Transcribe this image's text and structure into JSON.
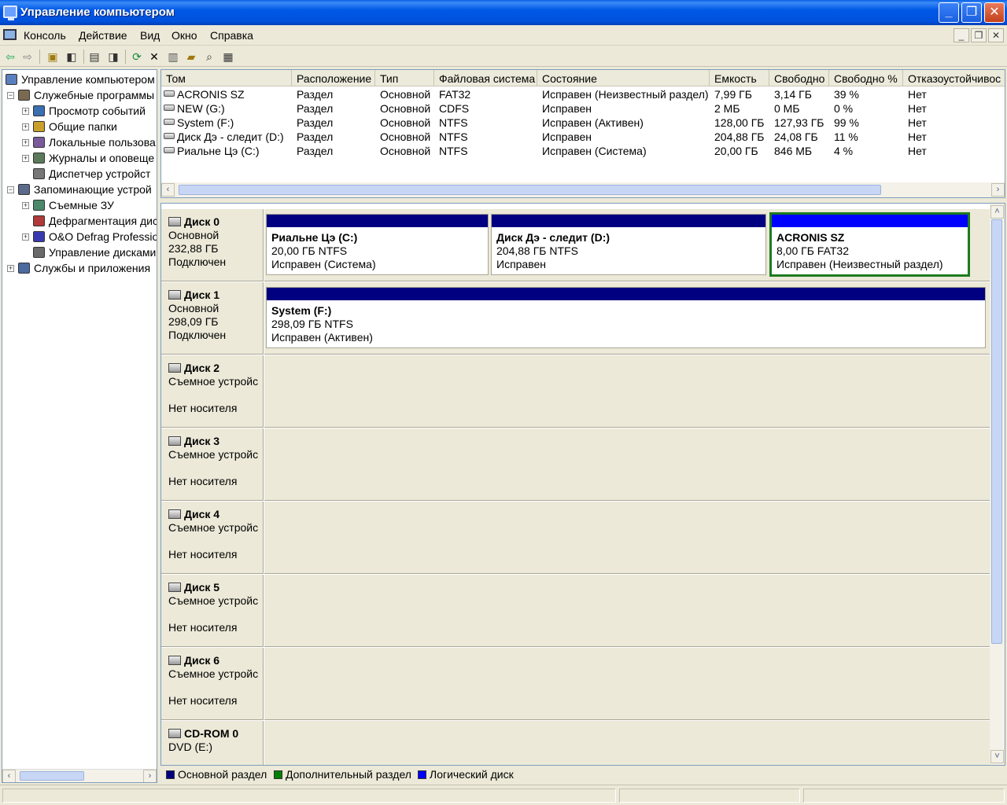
{
  "window": {
    "title": "Управление компьютером"
  },
  "menu": [
    "Консоль",
    "Действие",
    "Вид",
    "Окно",
    "Справка"
  ],
  "tree": [
    {
      "label": "Управление компьютером",
      "indent": 0,
      "exp": "",
      "icon": "computer-icon"
    },
    {
      "label": "Служебные программы",
      "indent": 1,
      "exp": "−",
      "icon": "tools-icon"
    },
    {
      "label": "Просмотр событий",
      "indent": 2,
      "exp": "+",
      "icon": "event-viewer-icon"
    },
    {
      "label": "Общие папки",
      "indent": 2,
      "exp": "+",
      "icon": "shared-folder-icon"
    },
    {
      "label": "Локальные пользова",
      "indent": 2,
      "exp": "+",
      "icon": "users-icon"
    },
    {
      "label": "Журналы и оповеще",
      "indent": 2,
      "exp": "+",
      "icon": "logs-icon"
    },
    {
      "label": "Диспетчер устройст",
      "indent": 2,
      "exp": "",
      "icon": "device-manager-icon"
    },
    {
      "label": "Запоминающие устрой",
      "indent": 1,
      "exp": "−",
      "icon": "storage-icon"
    },
    {
      "label": "Съемные ЗУ",
      "indent": 2,
      "exp": "+",
      "icon": "removable-storage-icon"
    },
    {
      "label": "Дефрагментация дис",
      "indent": 2,
      "exp": "",
      "icon": "defrag-icon"
    },
    {
      "label": "O&O Defrag Professio",
      "indent": 2,
      "exp": "+",
      "icon": "oo-defrag-icon"
    },
    {
      "label": "Управление дисками",
      "indent": 2,
      "exp": "",
      "icon": "disk-management-icon"
    },
    {
      "label": "Службы и приложения",
      "indent": 1,
      "exp": "+",
      "icon": "services-icon"
    }
  ],
  "columns": [
    "Том",
    "Расположение",
    "Тип",
    "Файловая система",
    "Состояние",
    "Емкость",
    "Свободно",
    "Свободно %",
    "Отказоустойчивос"
  ],
  "volumes": [
    [
      "ACRONIS SZ",
      "Раздел",
      "Основной",
      "FAT32",
      "Исправен (Неизвестный раздел)",
      "7,99 ГБ",
      "3,14 ГБ",
      "39 %",
      "Нет"
    ],
    [
      "NEW (G:)",
      "Раздел",
      "Основной",
      "CDFS",
      "Исправен",
      "2 МБ",
      "0 МБ",
      "0 %",
      "Нет"
    ],
    [
      "System (F:)",
      "Раздел",
      "Основной",
      "NTFS",
      "Исправен (Активен)",
      "128,00 ГБ",
      "127,93 ГБ",
      "99 %",
      "Нет"
    ],
    [
      "Диск Дэ - следит (D:)",
      "Раздел",
      "Основной",
      "NTFS",
      "Исправен",
      "204,88 ГБ",
      "24,08 ГБ",
      "11 %",
      "Нет"
    ],
    [
      "Риальне Цэ (C:)",
      "Раздел",
      "Основной",
      "NTFS",
      "Исправен (Система)",
      "20,00 ГБ",
      "846 МБ",
      "4 %",
      "Нет"
    ]
  ],
  "disks": [
    {
      "name": "Диск 0",
      "line2": "Основной",
      "line3": "232,88 ГБ",
      "line4": "Подключен",
      "partitions": [
        {
          "name": "Риальне Цэ  (C:)",
          "size": "20,00 ГБ NTFS",
          "status": "Исправен (Система)"
        },
        {
          "name": "Диск Дэ - следит  (D:)",
          "size": "204,88 ГБ NTFS",
          "status": "Исправен"
        },
        {
          "name": "ACRONIS SZ",
          "size": "8,00 ГБ FAT32",
          "status": "Исправен (Неизвестный раздел)"
        }
      ]
    },
    {
      "name": "Диск 1",
      "line2": "Основной",
      "line3": "298,09 ГБ",
      "line4": "Подключен",
      "partitions": [
        {
          "name": "System  (F:)",
          "size": "298,09 ГБ NTFS",
          "status": "Исправен (Активен)"
        }
      ]
    },
    {
      "name": "Диск 2",
      "line2": "Съемное устройс",
      "line3": "",
      "line4": "Нет носителя",
      "partitions": []
    },
    {
      "name": "Диск 3",
      "line2": "Съемное устройс",
      "line3": "",
      "line4": "Нет носителя",
      "partitions": []
    },
    {
      "name": "Диск 4",
      "line2": "Съемное устройс",
      "line3": "",
      "line4": "Нет носителя",
      "partitions": []
    },
    {
      "name": "Диск 5",
      "line2": "Съемное устройс",
      "line3": "",
      "line4": "Нет носителя",
      "partitions": []
    },
    {
      "name": "Диск 6",
      "line2": "Съемное устройс",
      "line3": "",
      "line4": "Нет носителя",
      "partitions": []
    },
    {
      "name": "CD-ROM 0",
      "line2": "DVD (E:)",
      "line3": "",
      "line4": "",
      "partitions": []
    }
  ],
  "legend": [
    {
      "label": "Основной раздел",
      "color": "#000080"
    },
    {
      "label": "Дополнительный раздел",
      "color": "#008000"
    },
    {
      "label": "Логический диск",
      "color": "#0000ff"
    }
  ],
  "colors": {
    "primary_bar": "#000080",
    "logical_bar": "#0000ff",
    "selection": "#1e7b1e"
  }
}
